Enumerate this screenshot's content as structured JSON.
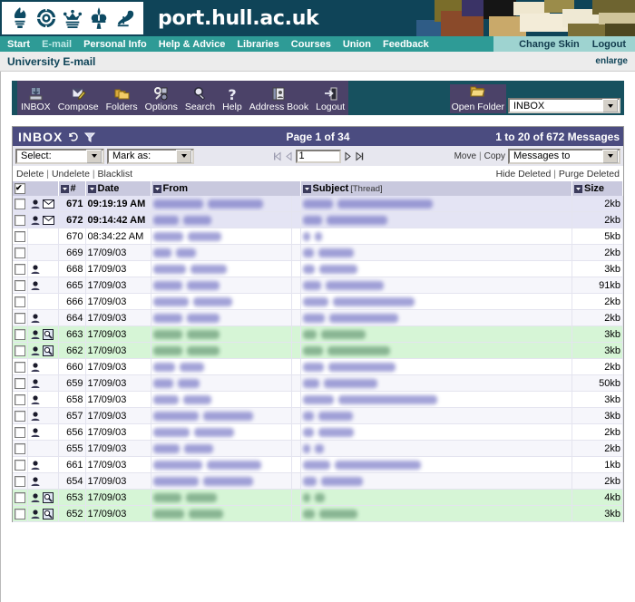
{
  "banner": {
    "site_title": "port.hull.ac.uk",
    "crest_icons": [
      "flaming-torch-icon",
      "tudor-rose-icon",
      "crown-icon",
      "fleur-de-lis-icon",
      "bird-icon"
    ]
  },
  "nav": {
    "left_items": [
      {
        "label": "Start",
        "active": false
      },
      {
        "label": "E-mail",
        "active": true
      },
      {
        "label": "Personal Info",
        "active": false
      },
      {
        "label": "Help & Advice",
        "active": false
      },
      {
        "label": "Libraries",
        "active": false
      },
      {
        "label": "Courses",
        "active": false
      },
      {
        "label": "Union",
        "active": false
      },
      {
        "label": "Feedback",
        "active": false
      }
    ],
    "right_items": [
      {
        "label": "Change Skin"
      },
      {
        "label": "Logout"
      }
    ]
  },
  "pagehead": {
    "title": "University E-mail",
    "enlarge": "enlarge"
  },
  "toolbar": {
    "items": [
      {
        "label": "INBOX",
        "icon": "inbox-tray-icon"
      },
      {
        "label": "Compose",
        "icon": "compose-pencil-icon"
      },
      {
        "label": "Folders",
        "icon": "folders-icon"
      },
      {
        "label": "Options",
        "icon": "options-tools-icon"
      },
      {
        "label": "Search",
        "icon": "magnifier-icon"
      },
      {
        "label": "Help",
        "icon": "question-mark-icon"
      },
      {
        "label": "Address Book",
        "icon": "address-book-icon"
      },
      {
        "label": "Logout",
        "icon": "logout-door-icon"
      }
    ],
    "open_folder_label": "Open Folder",
    "open_folder_icon": "open-folder-icon",
    "folder_select_value": "INBOX"
  },
  "mailbox": {
    "name": "INBOX",
    "refresh_icon": "refresh-icon",
    "filter_icon": "filter-funnel-icon",
    "page_text": "Page 1 of 34",
    "count_text": "1 to 20 of 672 Messages",
    "select_value": "Select:",
    "markas_value": "Mark as:",
    "page_input_value": "1",
    "nav_first_icon": "first-page-icon",
    "nav_prev_icon": "prev-page-icon",
    "nav_next_icon": "next-page-icon",
    "nav_last_icon": "last-page-icon",
    "move_label": "Move",
    "copy_label": "Copy",
    "divider": "|",
    "messages_to_value": "Messages to"
  },
  "actions": {
    "left": [
      {
        "label": "Delete"
      },
      {
        "label": "Undelete"
      },
      {
        "label": "Blacklist"
      }
    ],
    "right": [
      {
        "label": "Hide Deleted"
      },
      {
        "label": "Purge Deleted"
      }
    ],
    "separator": "|"
  },
  "columns": {
    "check_icon": "select-all-checkbox",
    "num": "#",
    "date": "Date",
    "from": "From",
    "subject": "Subject",
    "thread": "[Thread]",
    "size": "Size",
    "sort_icon": "sort-arrow-icon"
  },
  "messages": [
    {
      "num": "671",
      "date": "09:19:19 AM",
      "bold": true,
      "size": "2kb",
      "row": "unread",
      "icons": [
        "user-icon",
        "envelope-icon"
      ],
      "from_w": 122,
      "subj_w": 150
    },
    {
      "num": "672",
      "date": "09:14:42 AM",
      "bold": true,
      "size": "2kb",
      "row": "unread",
      "icons": [
        "user-icon",
        "envelope-icon"
      ],
      "from_w": 62,
      "subj_w": 96
    },
    {
      "num": "670",
      "date": "08:34:22 AM",
      "bold": false,
      "size": "5kb",
      "row": "read",
      "icons": [],
      "from_w": 74,
      "subj_w": 12
    },
    {
      "num": "669",
      "date": "17/09/03",
      "bold": false,
      "size": "2kb",
      "row": "alt",
      "icons": [],
      "from_w": 44,
      "subj_w": 56
    },
    {
      "num": "668",
      "date": "17/09/03",
      "bold": false,
      "size": "3kb",
      "row": "read",
      "icons": [
        "user-icon"
      ],
      "from_w": 80,
      "subj_w": 60
    },
    {
      "num": "665",
      "date": "17/09/03",
      "bold": false,
      "size": "91kb",
      "row": "alt",
      "icons": [
        "user-icon"
      ],
      "from_w": 72,
      "subj_w": 92
    },
    {
      "num": "666",
      "date": "17/09/03",
      "bold": false,
      "size": "2kb",
      "row": "read",
      "icons": [],
      "from_w": 86,
      "subj_w": 128
    },
    {
      "num": "664",
      "date": "17/09/03",
      "bold": false,
      "size": "2kb",
      "row": "alt",
      "icons": [
        "user-icon"
      ],
      "from_w": 72,
      "subj_w": 108
    },
    {
      "num": "663",
      "date": "17/09/03",
      "bold": false,
      "size": "3kb",
      "row": "flag",
      "icons": [
        "user-icon",
        "attachment-icon"
      ],
      "from_w": 72,
      "subj_w": 70
    },
    {
      "num": "662",
      "date": "17/09/03",
      "bold": false,
      "size": "3kb",
      "row": "flag",
      "icons": [
        "user-icon",
        "attachment-icon"
      ],
      "from_w": 72,
      "subj_w": 98
    },
    {
      "num": "660",
      "date": "17/09/03",
      "bold": false,
      "size": "2kb",
      "row": "read",
      "icons": [
        "user-icon"
      ],
      "from_w": 54,
      "subj_w": 106
    },
    {
      "num": "659",
      "date": "17/09/03",
      "bold": false,
      "size": "50kb",
      "row": "alt",
      "icons": [
        "user-icon"
      ],
      "from_w": 48,
      "subj_w": 84
    },
    {
      "num": "658",
      "date": "17/09/03",
      "bold": false,
      "size": "3kb",
      "row": "read",
      "icons": [
        "user-icon"
      ],
      "from_w": 62,
      "subj_w": 156
    },
    {
      "num": "657",
      "date": "17/09/03",
      "bold": false,
      "size": "3kb",
      "row": "alt",
      "icons": [
        "user-icon"
      ],
      "from_w": 110,
      "subj_w": 54
    },
    {
      "num": "656",
      "date": "17/09/03",
      "bold": false,
      "size": "2kb",
      "row": "read",
      "icons": [
        "user-icon"
      ],
      "from_w": 88,
      "subj_w": 56
    },
    {
      "num": "655",
      "date": "17/09/03",
      "bold": false,
      "size": "2kb",
      "row": "alt",
      "icons": [],
      "from_w": 64,
      "subj_w": 14
    },
    {
      "num": "661",
      "date": "17/09/03",
      "bold": false,
      "size": "1kb",
      "row": "read",
      "icons": [
        "user-icon"
      ],
      "from_w": 120,
      "subj_w": 136
    },
    {
      "num": "654",
      "date": "17/09/03",
      "bold": false,
      "size": "2kb",
      "row": "alt",
      "icons": [
        "user-icon"
      ],
      "from_w": 110,
      "subj_w": 66
    },
    {
      "num": "653",
      "date": "17/09/03",
      "bold": false,
      "size": "4kb",
      "row": "flag",
      "icons": [
        "user-icon",
        "attachment-icon"
      ],
      "from_w": 68,
      "subj_w": 16
    },
    {
      "num": "652",
      "date": "17/09/03",
      "bold": false,
      "size": "3kb",
      "row": "flag",
      "icons": [
        "user-icon",
        "attachment-icon"
      ],
      "from_w": 76,
      "subj_w": 60
    }
  ]
}
